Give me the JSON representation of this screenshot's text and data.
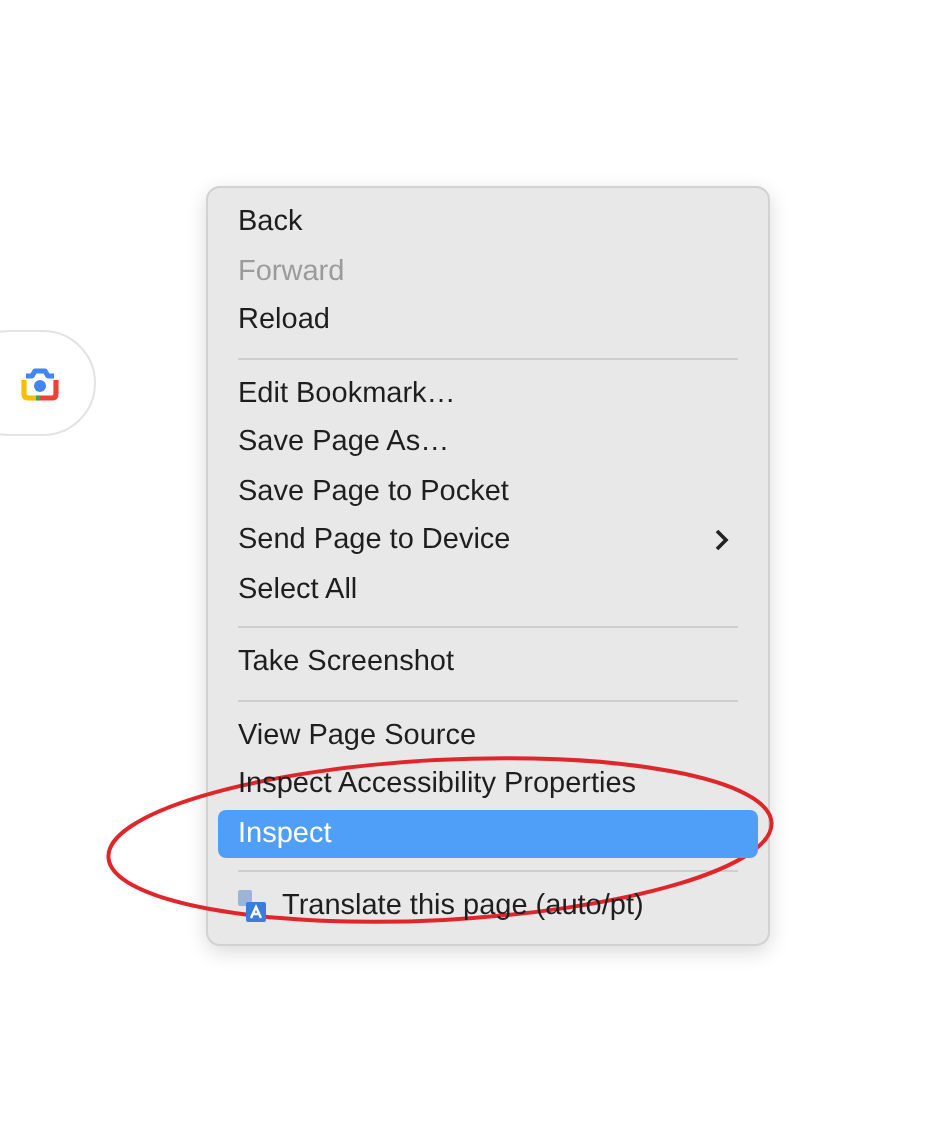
{
  "menu": {
    "items": [
      {
        "kind": "item",
        "label": "Back",
        "disabled": false,
        "selected": false
      },
      {
        "kind": "item",
        "label": "Forward",
        "disabled": true,
        "selected": false
      },
      {
        "kind": "item",
        "label": "Reload",
        "disabled": false,
        "selected": false
      },
      {
        "kind": "separator"
      },
      {
        "kind": "item",
        "label": "Edit Bookmark…",
        "disabled": false,
        "selected": false
      },
      {
        "kind": "item",
        "label": "Save Page As…",
        "disabled": false,
        "selected": false
      },
      {
        "kind": "item",
        "label": "Save Page to Pocket",
        "disabled": false,
        "selected": false
      },
      {
        "kind": "submenu",
        "label": "Send Page to Device",
        "disabled": false,
        "selected": false
      },
      {
        "kind": "item",
        "label": "Select All",
        "disabled": false,
        "selected": false
      },
      {
        "kind": "separator"
      },
      {
        "kind": "item",
        "label": "Take Screenshot",
        "disabled": false,
        "selected": false
      },
      {
        "kind": "separator"
      },
      {
        "kind": "item",
        "label": "View Page Source",
        "disabled": false,
        "selected": false
      },
      {
        "kind": "item",
        "label": "Inspect Accessibility Properties",
        "disabled": false,
        "selected": false
      },
      {
        "kind": "item",
        "label": "Inspect",
        "disabled": false,
        "selected": true
      },
      {
        "kind": "separator"
      },
      {
        "kind": "translate",
        "label": "Translate this page (auto/pt)",
        "disabled": false,
        "selected": false
      }
    ]
  }
}
